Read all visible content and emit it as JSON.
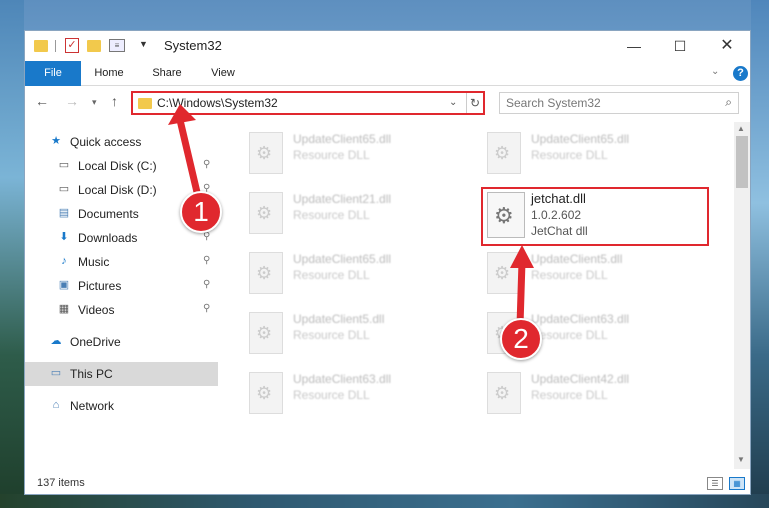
{
  "window": {
    "title": "System32",
    "minimize_label": "—",
    "maximize_label": "☐",
    "close_label": "✕"
  },
  "ribbon": {
    "tabs": [
      "File",
      "Home",
      "Share",
      "View"
    ],
    "expand_glyph": "⌄",
    "help_glyph": "?"
  },
  "nav": {
    "back_glyph": "←",
    "forward_glyph": "→",
    "recent_glyph": "▾",
    "up_glyph": "↑"
  },
  "address": {
    "path": "C:\\Windows\\System32",
    "dropdown_glyph": "⌄",
    "refresh_glyph": "↻"
  },
  "search": {
    "placeholder": "Search System32",
    "icon_glyph": "⌕"
  },
  "sidebar": {
    "items": [
      {
        "label": "Quick access",
        "icon": "star-icon",
        "glyph": "★",
        "color": "#1979ca"
      },
      {
        "label": "Local Disk (C:)",
        "icon": "drive-icon",
        "glyph": "▭",
        "color": "#555555"
      },
      {
        "label": "Local Disk (D:)",
        "icon": "drive-icon",
        "glyph": "▭",
        "color": "#555555"
      },
      {
        "label": "Documents",
        "icon": "documents-icon",
        "glyph": "▤",
        "color": "#4a7fb5"
      },
      {
        "label": "Downloads",
        "icon": "downloads-icon",
        "glyph": "⬇",
        "color": "#1979ca"
      },
      {
        "label": "Music",
        "icon": "music-icon",
        "glyph": "♪",
        "color": "#1979ca"
      },
      {
        "label": "Pictures",
        "icon": "pictures-icon",
        "glyph": "▣",
        "color": "#4a7fb5"
      },
      {
        "label": "Videos",
        "icon": "videos-icon",
        "glyph": "▦",
        "color": "#555555"
      },
      {
        "label": "OneDrive",
        "icon": "onedrive-icon",
        "glyph": "☁",
        "color": "#1979ca"
      },
      {
        "label": "This PC",
        "icon": "computer-icon",
        "glyph": "▭",
        "color": "#4a7fb5"
      },
      {
        "label": "Network",
        "icon": "network-icon",
        "glyph": "⌂",
        "color": "#4a7fb5"
      }
    ],
    "pin_glyph": "📌"
  },
  "files": [
    {
      "name": "UpdateClient65.dll",
      "type": "Resource DLL"
    },
    {
      "name": "UpdateClient65.dll",
      "type": "Resource DLL"
    },
    {
      "name": "UpdateClient21.dll",
      "type": "Resource DLL"
    },
    {
      "name": "UpdateClient65.dll",
      "type": "Resource DLL"
    },
    {
      "name": "UpdateClient5.dll",
      "type": "Resource DLL"
    },
    {
      "name": "UpdateClient5.dll",
      "type": "Resource DLL"
    },
    {
      "name": "UpdateClient63.dll",
      "type": "Resource DLL"
    },
    {
      "name": "UpdateClient63.dll",
      "type": "Resource DLL"
    },
    {
      "name": "UpdateClient42.dll",
      "type": "Resource DLL"
    }
  ],
  "highlighted_file": {
    "name": "jetchat.dll",
    "version": "1.0.2.602",
    "description": "JetChat dll",
    "icon": "dll-gear-icon"
  },
  "status": {
    "item_count": "137 items"
  },
  "annotations": [
    {
      "label": "1"
    },
    {
      "label": "2"
    }
  ],
  "colors": {
    "accent": "#1979ca",
    "annotation_red": "#e0282e"
  }
}
